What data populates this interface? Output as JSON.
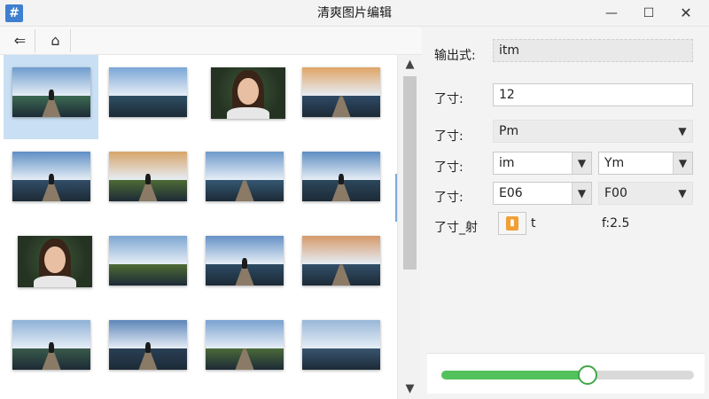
{
  "window": {
    "title": "清爽图片编辑",
    "app_icon_glyph": "#",
    "minimize_glyph": "—",
    "maximize_glyph": "☐",
    "close_glyph": "✕"
  },
  "toolbar": {
    "back_glyph": "⇐",
    "home_glyph": "⌂"
  },
  "gallery": {
    "selected_index": 0,
    "items": [
      {
        "kind": "figure",
        "sky": "#6e9ccd",
        "ground": "#3d6a52"
      },
      {
        "kind": "lake",
        "sky": "#7aa6d6",
        "ground": "#2e4f63"
      },
      {
        "kind": "portrait"
      },
      {
        "kind": "road",
        "sky": "#e0a466",
        "ground": "#2f4a66"
      },
      {
        "kind": "figure",
        "sky": "#5f8fc4",
        "ground": "#324e67"
      },
      {
        "kind": "figure",
        "sky": "#d7a56a",
        "ground": "#4e6a34"
      },
      {
        "kind": "road",
        "sky": "#6d9acb",
        "ground": "#355872"
      },
      {
        "kind": "figure",
        "sky": "#5e8ec2",
        "ground": "#2c475c"
      },
      {
        "kind": "portrait"
      },
      {
        "kind": "lake",
        "sky": "#7ea7d2",
        "ground": "#4f6b35"
      },
      {
        "kind": "figure",
        "sky": "#6692c6",
        "ground": "#2d4b63"
      },
      {
        "kind": "road",
        "sky": "#d6996a",
        "ground": "#34506a"
      },
      {
        "kind": "figure",
        "sky": "#8fb1d6",
        "ground": "#3a5a4a"
      },
      {
        "kind": "figure",
        "sky": "#5d86b8",
        "ground": "#2a3f55"
      },
      {
        "kind": "road",
        "sky": "#7aa2cf",
        "ground": "#4b6a38"
      },
      {
        "kind": "lake",
        "sky": "#9ab7d8",
        "ground": "#3a5570"
      }
    ]
  },
  "scrollbar": {
    "up_glyph": "▲",
    "down_glyph": "▼"
  },
  "settings": {
    "caret_glyph": "▼",
    "output_format": {
      "label": "输出式:",
      "value": "itm"
    },
    "size": {
      "label": "了寸:",
      "value": "12"
    },
    "mode": {
      "label": "了寸:",
      "value": "Pm"
    },
    "unit": {
      "label": "了寸:",
      "value_a": "im",
      "value_b": "Ym"
    },
    "color": {
      "label": "了寸:",
      "value_a": "E06",
      "value_b": "F00"
    },
    "ratio": {
      "label": "了寸_射",
      "chip_glyph": "▮",
      "chip_text": "t",
      "value": "f:2.5"
    }
  },
  "slider": {
    "value": 0.58,
    "fill_color": "#53c25d"
  }
}
